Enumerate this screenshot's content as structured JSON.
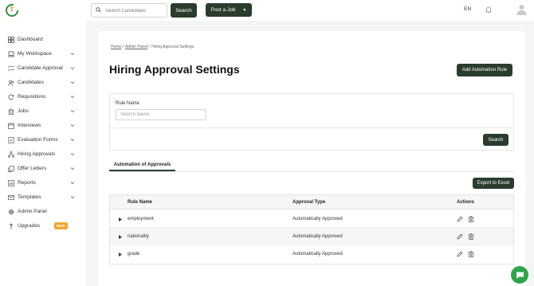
{
  "colors": {
    "accent_dark": "#2a3d2d",
    "brand_green": "#2f8f43",
    "brand_yellow": "#e0a020",
    "badge_orange": "#f0a830",
    "chat_green": "#2fa54a"
  },
  "logo": {
    "letter": "T",
    "icon": "app-logo-icon"
  },
  "topbar": {
    "search_placeholder": "Search Candidates",
    "search_button": "Search",
    "post_job_button": "Post a Job",
    "language": "EN",
    "icons": [
      "search-icon",
      "chevron-down-icon",
      "bell-icon",
      "avatar-icon"
    ]
  },
  "sidebar": {
    "items": [
      {
        "label": "Dashboard",
        "icon": "dashboard-icon",
        "has_arrow": false
      },
      {
        "label": "My Workspace",
        "icon": "laptop-icon",
        "has_arrow": true
      },
      {
        "label": "Candidate Approval",
        "icon": "checklist-icon",
        "has_arrow": true
      },
      {
        "label": "Candidates",
        "icon": "people-icon",
        "has_arrow": true
      },
      {
        "label": "Requisitions",
        "icon": "refresh-icon",
        "has_arrow": true
      },
      {
        "label": "Jobs",
        "icon": "building-icon",
        "has_arrow": true
      },
      {
        "label": "Interviews",
        "icon": "calendar-icon",
        "has_arrow": true
      },
      {
        "label": "Evaluation Forms",
        "icon": "form-icon",
        "has_arrow": true
      },
      {
        "label": "Hiring Approvals",
        "icon": "hierarchy-icon",
        "has_arrow": true
      },
      {
        "label": "Offer Letters",
        "icon": "copy-icon",
        "has_arrow": true
      },
      {
        "label": "Reports",
        "icon": "chart-icon",
        "has_arrow": true
      },
      {
        "label": "Templates",
        "icon": "mail-icon",
        "has_arrow": true
      },
      {
        "label": "Admin Panel",
        "icon": "gear-icon",
        "has_arrow": false
      },
      {
        "label": "Upgrades",
        "icon": "upgrade-icon",
        "has_arrow": false,
        "badge": "NEW"
      }
    ]
  },
  "main": {
    "breadcrumb": {
      "home": "Home",
      "admin": "Admin Panel",
      "current": "Hiring Approval Settings",
      "separator": "/"
    },
    "title": "Hiring Approval Settings",
    "add_rule_button": "Add Automation Rule",
    "filter": {
      "label": "Rule Name",
      "placeholder": "Search Name",
      "search_button": "Search"
    },
    "tab": "Automation of Approvals",
    "export_button": "Export to Excel",
    "table": {
      "columns": [
        "Rule Name",
        "Approval Type",
        "Actions"
      ],
      "rows": [
        {
          "rule_name": "employment",
          "approval_type": "Automatically Approved"
        },
        {
          "rule_name": "nationality",
          "approval_type": "Automatically Approved"
        },
        {
          "rule_name": "grade",
          "approval_type": "Automatically Approved"
        }
      ],
      "row_icons": [
        "caret-right-icon",
        "edit-pencil-icon",
        "trash-icon"
      ]
    }
  },
  "chat": {
    "icon": "chat-icon"
  }
}
